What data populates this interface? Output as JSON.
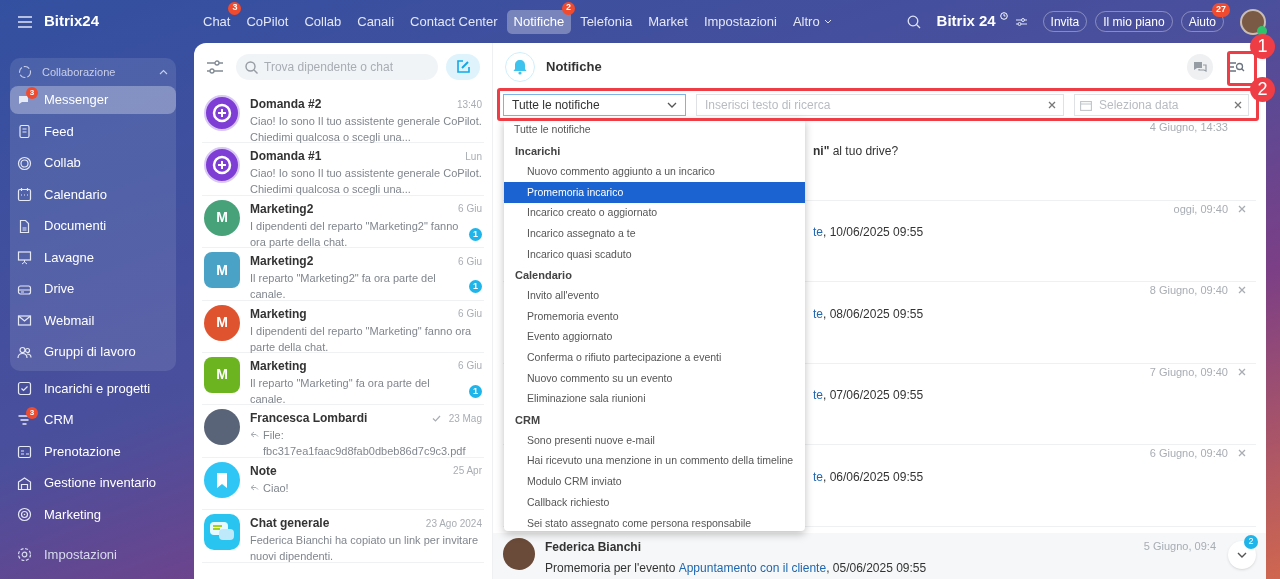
{
  "header": {
    "logo": "Bitrix24",
    "tabs": [
      {
        "label": "Chat",
        "selected": false,
        "badge": "3"
      },
      {
        "label": "CoPilot",
        "selected": false
      },
      {
        "label": "Collab",
        "selected": false
      },
      {
        "label": "Canali",
        "selected": false
      },
      {
        "label": "Contact Center",
        "selected": false
      },
      {
        "label": "Notifiche",
        "selected": true,
        "badge": "2"
      },
      {
        "label": "Telefonia",
        "selected": false
      },
      {
        "label": "Market",
        "selected": false
      },
      {
        "label": "Impostazioni",
        "selected": false
      },
      {
        "label": "Altro",
        "selected": false,
        "dropdown": true
      }
    ],
    "brand": "Bitrix",
    "brand_num": "24",
    "buttons": [
      {
        "label": "Invita"
      },
      {
        "label": "Il mio piano"
      },
      {
        "label": "Aiuto",
        "badge": "27"
      }
    ]
  },
  "sidebar": {
    "group": {
      "label": "Collaborazione",
      "expanded": true,
      "items": [
        {
          "label": "Messenger",
          "selected": true,
          "badge": "3"
        },
        {
          "label": "Feed",
          "selected": false
        },
        {
          "label": "Collab",
          "selected": false
        },
        {
          "label": "Calendario",
          "selected": false
        },
        {
          "label": "Documenti",
          "selected": false
        },
        {
          "label": "Lavagne",
          "selected": false
        },
        {
          "label": "Drive",
          "selected": false
        },
        {
          "label": "Webmail",
          "selected": false
        },
        {
          "label": "Gruppi di lavoro",
          "selected": false
        }
      ]
    },
    "items": [
      {
        "label": "Incarichi e progetti",
        "selected": false
      },
      {
        "label": "CRM",
        "selected": false,
        "badge": "3"
      },
      {
        "label": "Prenotazione",
        "selected": false
      },
      {
        "label": "Gestione inventario",
        "selected": false
      },
      {
        "label": "Marketing",
        "selected": false
      }
    ],
    "settings": "Impostazioni"
  },
  "chats": {
    "search_placeholder": "Trova dipendente o chat",
    "items": [
      {
        "kind": "copilot",
        "title": "Domanda #2",
        "time": "13:40",
        "preview": "Ciao! Io sono Il tuo assistente generale CoPilot. Chiedimi qualcosa o scegli una..."
      },
      {
        "kind": "copilot",
        "title": "Domanda #1",
        "time": "Lun",
        "preview": "Ciao! Io sono Il tuo assistente generale CoPilot. Chiedimi qualcosa o scegli una..."
      },
      {
        "kind": "letter",
        "letter": "M",
        "color": "#47a27a",
        "title": "Marketing2",
        "time": "6 Giu",
        "preview": "I dipendenti del reparto \"Marketing2\" fanno ora parte della chat.",
        "unread": "1"
      },
      {
        "kind": "channel",
        "letter": "M",
        "color": "#4aa3c7",
        "title": "Marketing2",
        "time": "6 Giu",
        "preview": "Il reparto \"Marketing2\" fa ora parte del canale.",
        "unread": "1"
      },
      {
        "kind": "letter",
        "letter": "M",
        "color": "#e0532f",
        "title": "Marketing",
        "time": "6 Giu",
        "preview": "I dipendenti del reparto \"Marketing\" fanno ora parte della chat."
      },
      {
        "kind": "channel",
        "letter": "M",
        "color": "#6cb521",
        "title": "Marketing",
        "time": "6 Giu",
        "preview": "Il reparto \"Marketing\" fa ora parte del canale.",
        "unread": "1"
      },
      {
        "kind": "photo",
        "title": "Francesca Lombardi",
        "time": "23 Mag",
        "read": true,
        "reply": true,
        "preview": "File: fbc317ea1faac9d8fab0dbeb86d7c9c3.pdf"
      },
      {
        "kind": "note",
        "title": "Note",
        "time": "25 Apr",
        "reply": true,
        "preview": "Ciao!"
      },
      {
        "kind": "general",
        "title": "Chat generale",
        "time": "23 Ago 2024",
        "preview": "Federica Bianchi ha copiato un link per invitare nuovi dipendenti."
      }
    ]
  },
  "notifications": {
    "title": "Notifiche",
    "filter": {
      "value": "Tutte le notifiche",
      "search_placeholder": "Inserisci testo di ricerca",
      "date_placeholder": "Seleziona data"
    },
    "dropdown": [
      {
        "kind": "option",
        "label": "Tutte le notifiche",
        "selected": false
      },
      {
        "kind": "group",
        "label": "Incarichi",
        "children": [
          {
            "label": "Nuovo commento aggiunto a un incarico",
            "selected": false
          },
          {
            "label": "Promemoria incarico",
            "selected": true
          },
          {
            "label": "Incarico creato o aggiornato",
            "selected": false
          },
          {
            "label": "Incarico assegnato a te",
            "selected": false
          },
          {
            "label": "Incarico quasi scaduto",
            "selected": false
          }
        ]
      },
      {
        "kind": "group",
        "label": "Calendario",
        "children": [
          {
            "label": "Invito all'evento",
            "selected": false
          },
          {
            "label": "Promemoria evento",
            "selected": false
          },
          {
            "label": "Evento aggiornato",
            "selected": false
          },
          {
            "label": "Conferma o rifiuto partecipazione a eventi",
            "selected": false
          },
          {
            "label": "Nuovo commento su un evento",
            "selected": false
          },
          {
            "label": "Eliminazione sala riunioni",
            "selected": false
          }
        ]
      },
      {
        "kind": "group",
        "label": "CRM",
        "children": [
          {
            "label": "Sono presenti nuove e-mail",
            "selected": false
          },
          {
            "label": "Hai ricevuto una menzione in un commento della timeline",
            "selected": false
          },
          {
            "label": "Modulo CRM inviato",
            "selected": false
          },
          {
            "label": "Callback richiesto",
            "selected": false
          },
          {
            "label": "Sei stato assegnato come persona responsabile",
            "selected": false
          }
        ]
      }
    ],
    "items": [
      {
        "time": "4 Giugno, 14:33",
        "closable": false,
        "text": "**ni\"** al tuo drive?"
      },
      {
        "time": "oggi, 09:40",
        "closable": true,
        "link": "te",
        "text": ", 10/06/2025 09:55"
      },
      {
        "time": "8 Giugno, 09:40",
        "closable": true,
        "link": "te",
        "text": ", 08/06/2025 09:55"
      },
      {
        "time": "7 Giugno, 09:40",
        "closable": true,
        "link": "te",
        "text": ", 07/06/2025 09:55"
      },
      {
        "time": "6 Giugno, 09:40",
        "closable": true,
        "link": "te",
        "text": ", 06/06/2025 09:55"
      },
      {
        "time": "5 Giugno, 09:4",
        "closable": false,
        "sender": "Federica Bianchi",
        "prefix": "Promemoria per l'evento ",
        "link": "Appuntamento con il cliente",
        "text": ", 05/06/2025 09:55"
      }
    ],
    "scroll_badge": "2"
  },
  "callouts": [
    "1",
    "2"
  ]
}
